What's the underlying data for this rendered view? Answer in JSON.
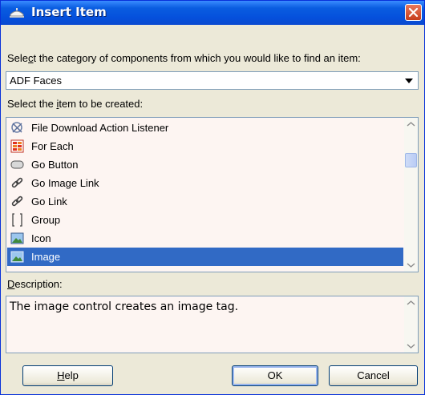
{
  "dialog": {
    "title": "Insert Item",
    "category_prompt": {
      "pre": "Sele",
      "key": "c",
      "post": "t the category of components from which you would like to find an item:"
    },
    "category_selected": "ADF Faces",
    "item_prompt": {
      "pre": "Select the ",
      "key": "i",
      "post": "tem to be created:"
    },
    "items": [
      {
        "label": "File Download Action Listener",
        "icon": "listener-icon"
      },
      {
        "label": "For Each",
        "icon": "for-each-icon"
      },
      {
        "label": "Go Button",
        "icon": "button-icon"
      },
      {
        "label": "Go Image Link",
        "icon": "link-icon"
      },
      {
        "label": "Go Link",
        "icon": "link-icon"
      },
      {
        "label": "Group",
        "icon": "group-bracket-icon"
      },
      {
        "label": "Icon",
        "icon": "image-icon"
      },
      {
        "label": "Image",
        "icon": "image-icon",
        "selected": true
      }
    ],
    "description_label": {
      "key": "D",
      "post": "escription:"
    },
    "description_text": "The image control creates an image tag.",
    "buttons": {
      "help": {
        "key": "H",
        "post": "elp"
      },
      "ok": "OK",
      "cancel": "Cancel"
    },
    "colors": {
      "titlebar": "#0550dc",
      "selection": "#316ac5",
      "dialog_bg": "#ece9d8"
    }
  }
}
